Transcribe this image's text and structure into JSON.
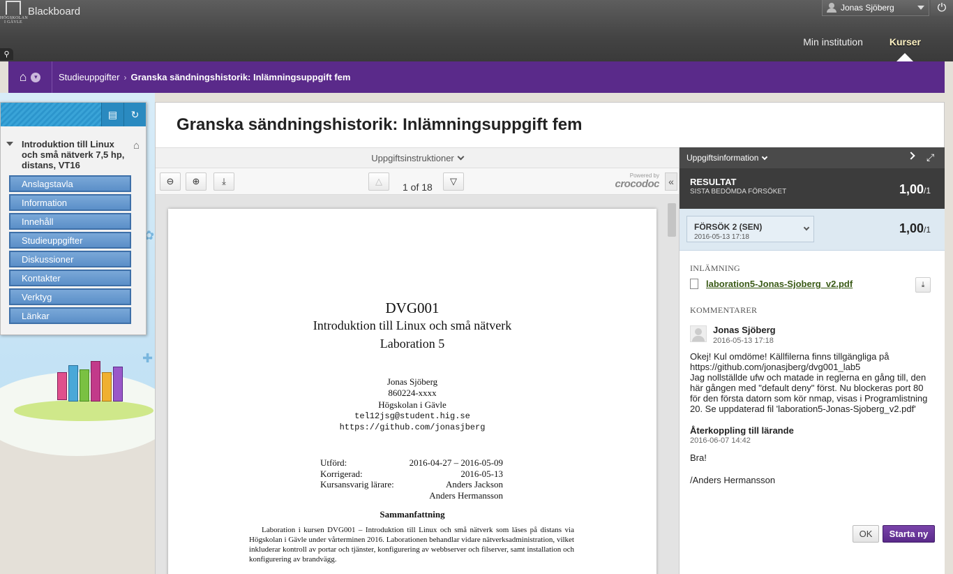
{
  "header": {
    "logo_text": "Blackboard",
    "logo_subtext": "HÖGSKOLAN I GÄVLE",
    "user_name": "Jonas Sjöberg",
    "power_icon": "power-icon",
    "nav": [
      "Min institution",
      "Kurser"
    ]
  },
  "breadcrumb": {
    "items": [
      "Studieuppgifter",
      "Granska sändningshistorik: Inlämningsuppgift fem"
    ]
  },
  "sidebar": {
    "course_title": "Introduktion till Linux och små nätverk 7,5 hp, distans, VT16",
    "menu": [
      "Anslagstavla",
      "Information",
      "Innehåll",
      "Studieuppgifter",
      "Diskussioner",
      "Kontakter",
      "Verktyg",
      "Länkar"
    ]
  },
  "main": {
    "title": "Granska sändningshistorik: Inlämningsuppgift fem",
    "instructions_label": "Uppgiftsinstruktioner",
    "pager": "1 of 18",
    "powered_by": "Powered by",
    "crocodoc": "crocodoc"
  },
  "document": {
    "code": "DVG001",
    "course": "Introduktion till Linux och små nätverk",
    "lab": "Laboration 5",
    "author": "Jonas Sjöberg",
    "id": "860224-xxxx",
    "school": "Högskolan i Gävle",
    "email": "tel12jsg@student.hig.se",
    "url": "https://github.com/jonasjberg",
    "meta": [
      {
        "k": "Utförd:",
        "v": "2016-04-27 – 2016-05-09"
      },
      {
        "k": "Korrigerad:",
        "v": "2016-05-13"
      },
      {
        "k": "Kursansvarig lärare:",
        "v": "Anders Jackson"
      },
      {
        "k": "",
        "v": "Anders Hermansson"
      }
    ],
    "abstract_heading": "Sammanfattning",
    "abstract": "Laboration i kursen DVG001 – Introduktion till Linux och små nätverk som läses på distans via Högskolan i Gävle under vårterminen 2016. Laborationen behandlar vidare nätverksadministration, vilket inkluderar kontroll av portar och tjänster, konfigurering av webbserver och filserver, samt installation och konfigurering av brandvägg."
  },
  "panel": {
    "header": "Uppgiftsinformation",
    "result_label": "RESULTAT",
    "result_sub": "SISTA BEDÖMDA FÖRSÖKET",
    "score": "1,00",
    "score_max": "/1",
    "attempt_label": "FÖRSÖK 2 (SEN)",
    "attempt_date": "2016-05-13 17:18",
    "submission_heading": "INLÄMNING",
    "file_name": "laboration5-Jonas-Sjoberg_v2.pdf",
    "comments_heading": "KOMMENTARER",
    "comment_author": "Jonas Sjöberg",
    "comment_date": "2016-05-13 17:18",
    "comment_body": "Okej! Kul omdöme! Källfilerna finns tillgängliga på https://github.com/jonasjberg/dvg001_lab5\nJag nollställde ufw och matade in reglerna en gång till, den här gången med \"default deny\" först. Nu blockeras port 80 för den första datorn som kör nmap, visas i Programlistning 20.  Se uppdaterad fil 'laboration5-Jonas-Sjoberg_v2.pdf'",
    "feedback_heading": "Återkoppling till lärande",
    "feedback_date": "2016-06-07 14:42",
    "feedback_body": "Bra!\n\n/Anders Hermansson",
    "ok_label": "OK",
    "new_label": "Starta ny"
  },
  "colors": {
    "accent": "#5a2a8a",
    "header_bg": "#444444",
    "link_green": "#3a5a16"
  }
}
